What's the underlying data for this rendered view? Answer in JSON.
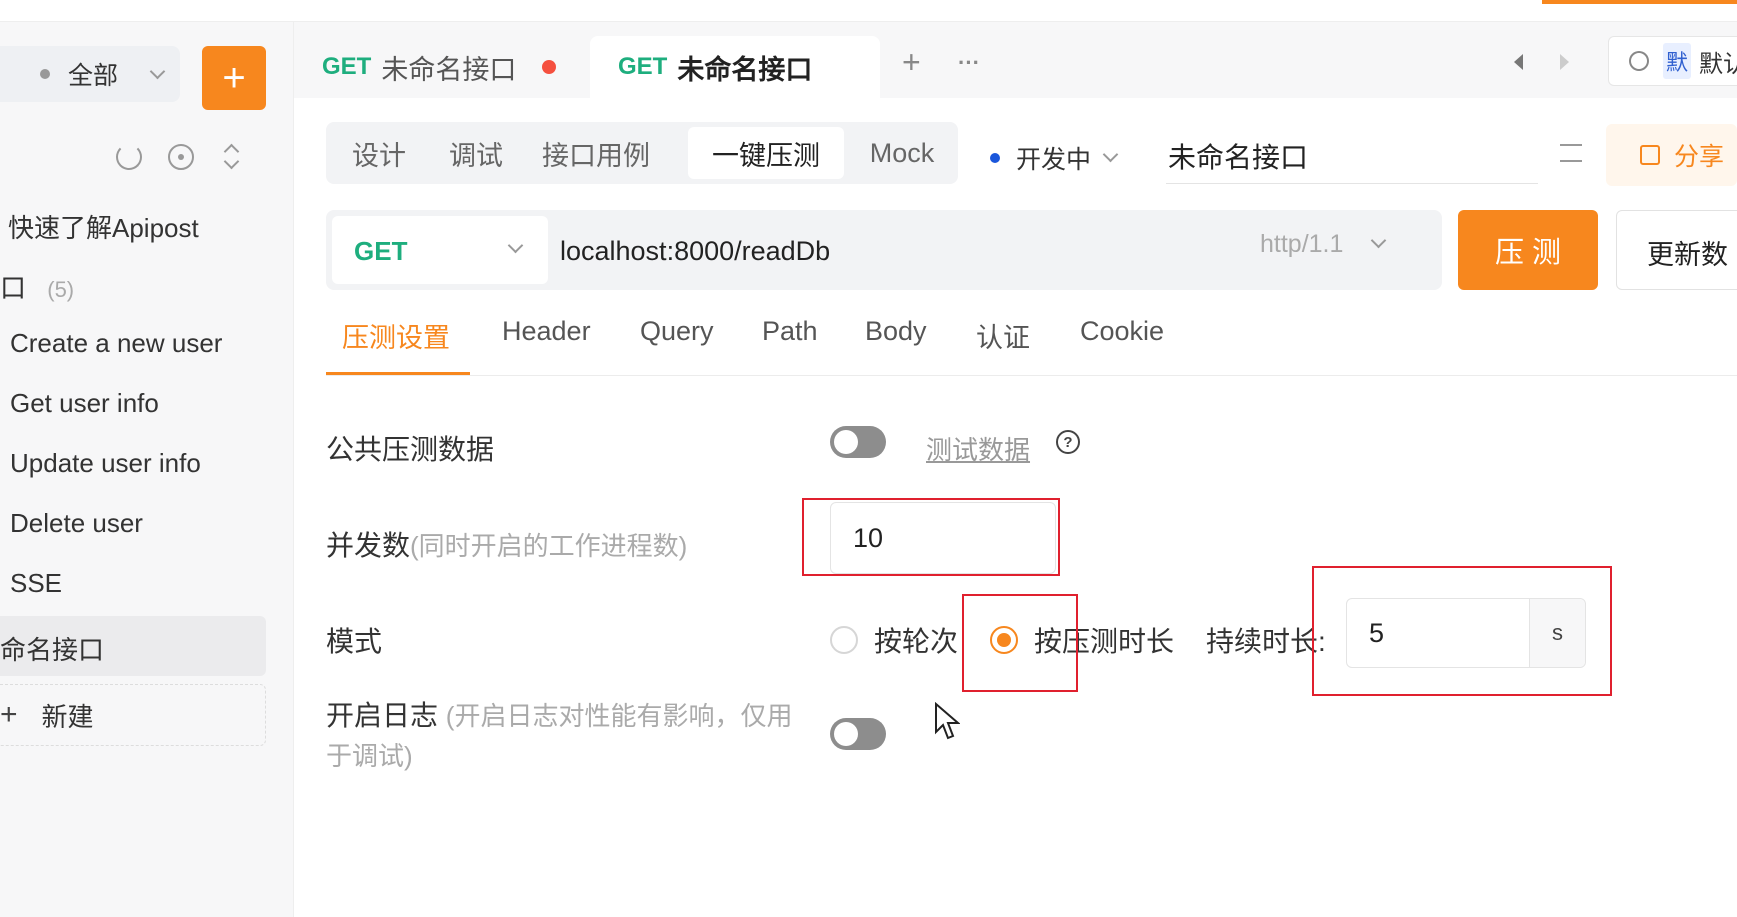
{
  "sidebar": {
    "filter_label": "全部",
    "add_label": "+",
    "items": [
      {
        "label": "快速了解Apipost"
      },
      {
        "label": "口",
        "count": "(5)"
      },
      {
        "label": "Create a new user"
      },
      {
        "label": "Get user info"
      },
      {
        "label": "Update user info"
      },
      {
        "label": "Delete user"
      },
      {
        "label": "SSE"
      },
      {
        "label": "命名接口"
      }
    ],
    "new_label": "新建"
  },
  "tabs": [
    {
      "method": "GET",
      "title": "未命名接口",
      "unsaved": true
    },
    {
      "method": "GET",
      "title": "未命名接口",
      "active": true
    }
  ],
  "tabs_actions": {
    "add": "+",
    "more": "···"
  },
  "env": {
    "badge": "默",
    "label": "默认"
  },
  "mode_tabs": [
    "设计",
    "调试",
    "接口用例",
    "一键压测",
    "Mock"
  ],
  "status": {
    "label": "开发中",
    "color": "#1a56db"
  },
  "api_name": "未命名接口",
  "share_label": "分享",
  "request": {
    "method": "GET",
    "url": "localhost:8000/readDb",
    "protocol": "http/1.1"
  },
  "buttons": {
    "run": "压 测",
    "update": "更新数"
  },
  "sub_tabs": [
    "压测设置",
    "Header",
    "Query",
    "Path",
    "Body",
    "认证",
    "Cookie"
  ],
  "settings": {
    "public_data_label": "公共压测数据",
    "test_data_link": "测试数据",
    "concurrency_label": "并发数",
    "concurrency_hint": "(同时开启的工作进程数)",
    "concurrency_value": "10",
    "mode_label": "模式",
    "mode_option_rounds": "按轮次",
    "mode_option_duration": "按压测时长",
    "duration_label": "持续时长:",
    "duration_value": "5",
    "duration_unit": "s",
    "log_label": "开启日志",
    "log_hint_1": "(开启日志对性能有影响，仅用",
    "log_hint_2": "于调试)"
  },
  "colors": {
    "accent": "#f7871e",
    "get": "#1eae7e",
    "highlight": "#e0202e"
  }
}
